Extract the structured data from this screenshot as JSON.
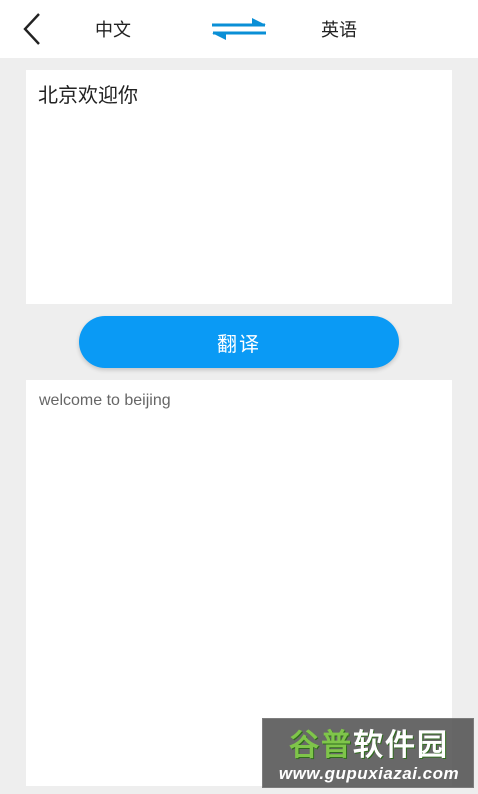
{
  "header": {
    "source_language": "中文",
    "target_language": "英语",
    "back_icon": "chevron-left-icon",
    "swap_icon": "swap-arrows-icon",
    "accent_color": "#0a8fd6"
  },
  "input": {
    "value": "北京欢迎你"
  },
  "action": {
    "translate_label": "翻译",
    "button_color": "#0a9af5"
  },
  "output": {
    "value": "welcome to beijing"
  },
  "watermark": {
    "name_part1": "谷普",
    "name_part2": "软件园",
    "url": "www.gupuxiazai.com"
  }
}
